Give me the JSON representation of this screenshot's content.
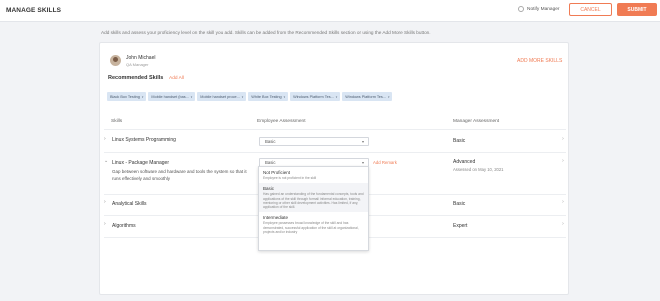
{
  "header": {
    "title": "MANAGE SKILLS",
    "notify_label": "Notify Manager",
    "cancel_label": "CANCEL",
    "submit_label": "SUBMIT"
  },
  "intro_text": "Add skills and assess your proficiency level on the skill you add. Skills can be added from the Recommended Skills section or using the Add More Skills button.",
  "employee": {
    "name": "John Michael",
    "role": "QA Manager"
  },
  "add_more_label": "ADD MORE SKILLS",
  "recommended": {
    "title": "Recommended Skills",
    "add_all": "Add All",
    "chips": [
      "Black Box Testing",
      "Mobile handset (bas...",
      "Mobile handset proce...",
      "White Box Testing",
      "Windows Platform Tes...",
      "Windows Platform Tes..."
    ]
  },
  "columns": {
    "skills": "Skills",
    "employee": "Employee Assessment",
    "manager": "Manager Assessment"
  },
  "skills": [
    {
      "name": "Linux Systems Programming",
      "employee_level": "Basic",
      "manager_level": "Basic"
    },
    {
      "name": "Linux - Package Manager",
      "description": "Gap between software and hardware and tools the system so that it runs effectively and smoothly",
      "employee_level": "Basic",
      "remark": "Add Remark",
      "manager_level": "Advanced",
      "manager_date": "Assessed on May 10, 2021"
    },
    {
      "name": "Analytical Skills",
      "manager_level": "Basic"
    },
    {
      "name": "Algorithms",
      "manager_level": "Expert"
    }
  ],
  "dropdown": {
    "options": [
      {
        "title": "Not Proficient",
        "desc": "Employee is not proficient in the skill"
      },
      {
        "title": "Basic",
        "desc": "Has gained an understanding of the fundamental concepts, tools and applications of the skill through formal/ informal education, training, mentoring or other skill development activities. Has limited, if any, application of the skill."
      },
      {
        "title": "Intermediate",
        "desc": "Employee possesses broad knowledge of the skill and has demonstrated, successful application of the skill at organizational, projects and/or industry"
      }
    ]
  },
  "colors": {
    "accent": "#f07b54",
    "chip_bg": "#d9e5f3"
  },
  "icons": {
    "chevron_right": "›",
    "chevron_down": "⌄",
    "caret": "▾"
  }
}
